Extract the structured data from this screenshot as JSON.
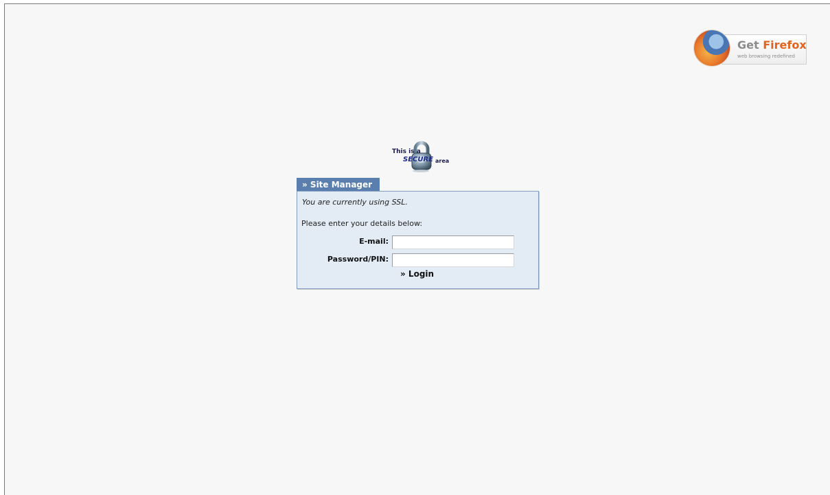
{
  "firefox_badge": {
    "get_text": "Get",
    "brand_text": "Firefox",
    "tagline": "web browsing redefined"
  },
  "secure_badge": {
    "this_is_a": "This is a",
    "secure_word": "SECURE",
    "area_word": "area"
  },
  "login_box": {
    "tab_label": "» Site Manager",
    "ssl_note": "You are currently using SSL.",
    "instructions": "Please enter your details below:",
    "email_label": "E-mail:",
    "email_value": "",
    "password_label": "Password/PIN:",
    "password_value": "",
    "login_button": "» Login"
  },
  "colors": {
    "page_background": "#f7f7f7",
    "tab_blue": "#5a7fae",
    "panel_background": "#e3ebf4",
    "panel_border": "#7f9cc0",
    "firefox_orange": "#e0641f"
  },
  "icons": {
    "firefox_logo": "firefox-globe-icon",
    "secure_lock": "padlock-icon"
  }
}
